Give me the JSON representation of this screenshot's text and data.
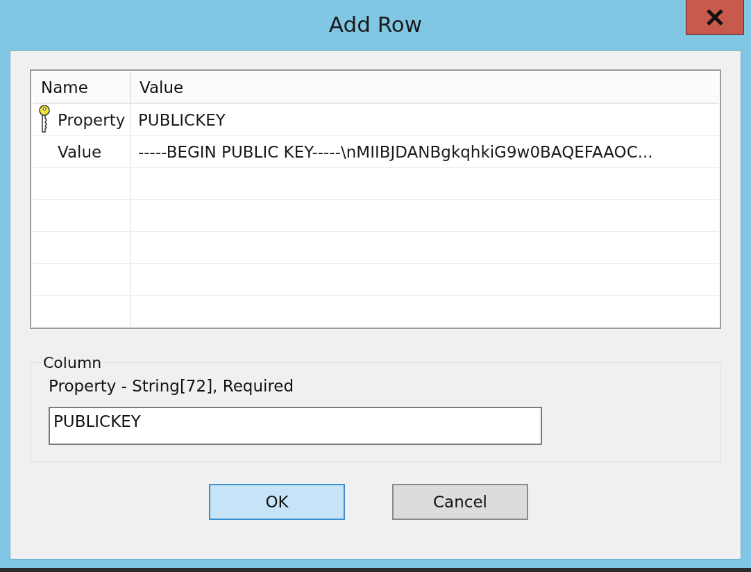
{
  "window": {
    "title": "Add Row"
  },
  "table": {
    "columns": [
      "Name",
      "Value"
    ],
    "rows": [
      {
        "name": "Property",
        "value": "PUBLICKEY",
        "key": true
      },
      {
        "name": "Value",
        "value": "-----BEGIN PUBLIC KEY-----\\nMIIBJDANBgkqhkiG9w0BAQEFAAOC...",
        "key": false
      }
    ]
  },
  "column_group": {
    "title": "Column",
    "description": "Property - String[72], Required",
    "field_value": "PUBLICKEY"
  },
  "buttons": [
    {
      "label": "OK",
      "default": true
    },
    {
      "label": "Cancel",
      "default": false
    }
  ]
}
